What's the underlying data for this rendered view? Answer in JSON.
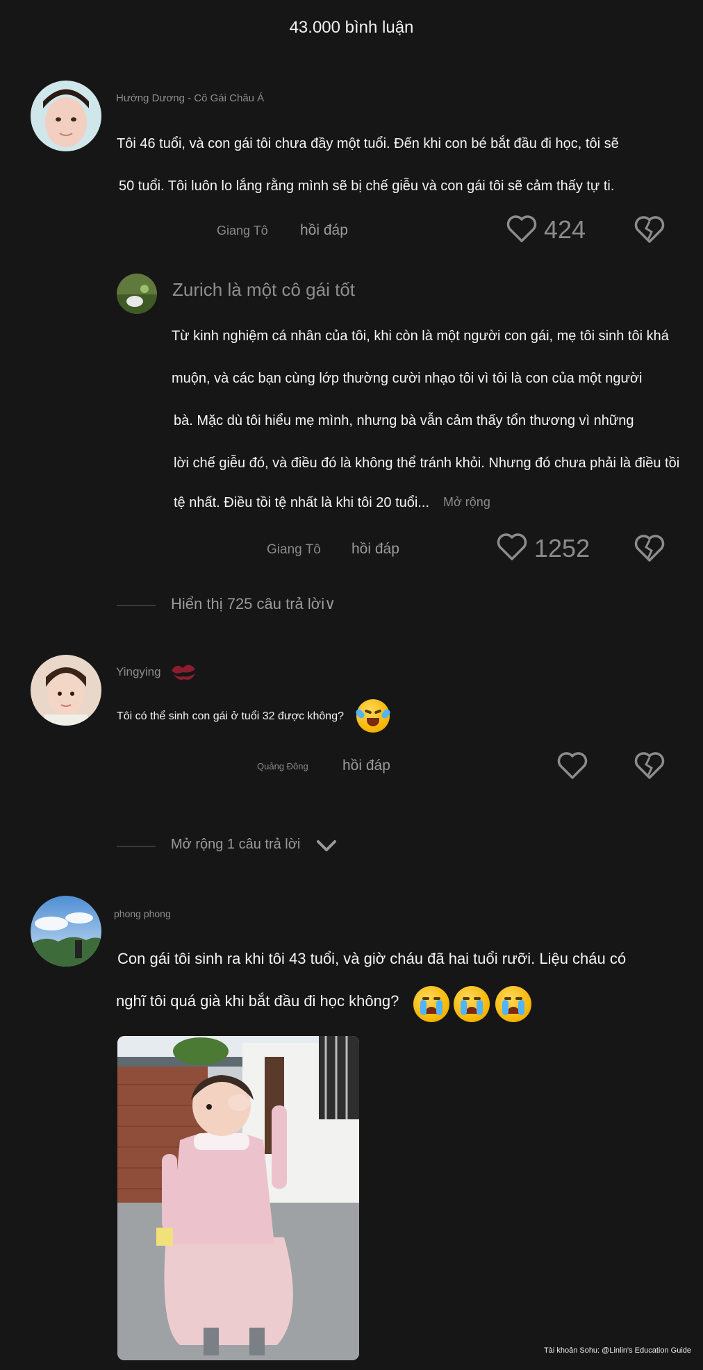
{
  "header": {
    "title": "43.000 bình luận"
  },
  "comments": [
    {
      "username": "Hướng Dương - Cô Gái Châu Á",
      "lines": [
        "Tôi 46 tuổi, và con gái tôi chưa đầy một tuổi. Đến khi con bé bắt đầu đi học, tôi sẽ",
        "50 tuổi. Tôi luôn lo lắng rằng mình sẽ bị chế giễu và con gái tôi sẽ cảm thấy tự ti."
      ],
      "location": "Giang Tô",
      "reply_label": "hồi đáp",
      "likes": "424"
    },
    {
      "username": "Yingying",
      "text": "Tôi có thể sinh con gái ở tuổi 32 được không?",
      "location": "Quảng Đông",
      "reply_label": "hồi đáp"
    },
    {
      "username": "phong phong",
      "lines": [
        "Con gái tôi sinh ra khi tôi 43 tuổi, và giờ cháu đã hai tuổi rưỡi. Liệu cháu có",
        "nghĩ tôi quá già khi bắt đầu đi học không?"
      ]
    }
  ],
  "nested_reply": {
    "username": "Zurich là một cô gái tốt",
    "lines": [
      "Từ kinh nghiệm cá nhân của tôi, khi còn là một người con gái, mẹ tôi sinh tôi khá",
      "muộn, và các bạn cùng lớp thường cười nhạo tôi vì tôi là con của một người",
      "bà. Mặc dù tôi hiểu mẹ mình, nhưng bà vẫn cảm thấy tổn thương vì những",
      "lời chế giễu đó, và điều đó là không thể tránh khỏi. Nhưng đó chưa phải là điều tồi",
      "tệ nhất. Điều tồi tệ nhất là khi tôi 20 tuổi..."
    ],
    "expand_label": "Mở rộng",
    "location": "Giang Tô",
    "reply_label": "hồi đáp",
    "likes": "1252"
  },
  "show_replies": {
    "label": "Hiển thị 725 câu trả lời∨"
  },
  "expand_replies": {
    "label": "Mở rộng 1 câu trả lời"
  },
  "watermark": "Tài khoản Sohu: @Linlin's Education Guide",
  "icons": [
    "heart-icon",
    "broken-heart-icon",
    "kiss-mark-icon",
    "laughing-crying-emoji-icon",
    "crying-emoji-icon",
    "chevron-down-icon"
  ],
  "colors": {
    "background": "#161616",
    "text": "#f4f4f4",
    "muted": "#8a8a8a"
  }
}
